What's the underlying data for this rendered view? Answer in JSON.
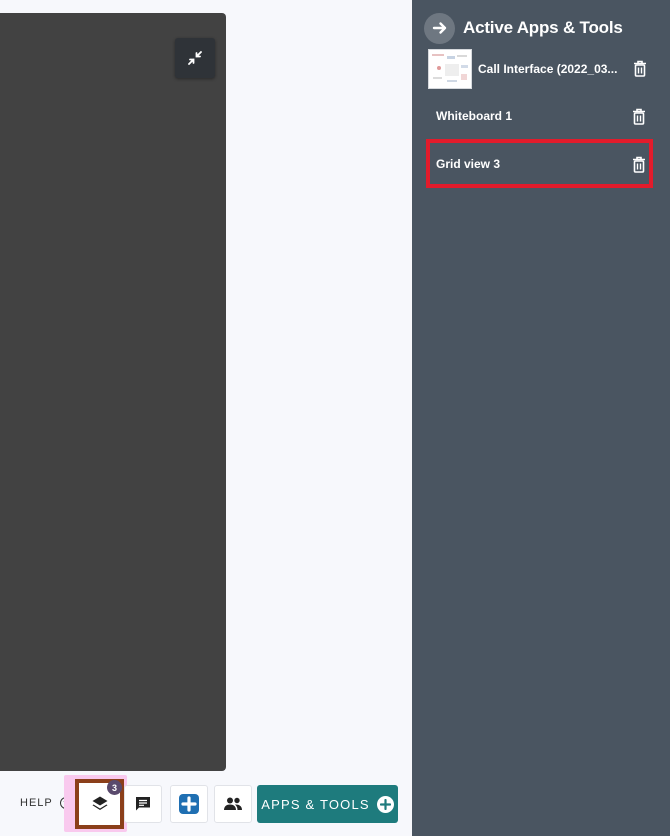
{
  "panel": {
    "title": "Active Apps & Tools",
    "items": [
      {
        "label": "Call Interface (2022_03..."
      },
      {
        "label": "Whiteboard 1"
      },
      {
        "label": "Grid view 3"
      }
    ]
  },
  "toolbar": {
    "help_label": "HELP",
    "help_icon_glyph": "?",
    "layers_badge": "3",
    "apps_tools_label": "APPS & TOOLS"
  },
  "colors": {
    "panel_bg": "#4a5561",
    "stage_bg": "#424242",
    "apps_button": "#1e7b7d",
    "highlight_red": "#e21b2b",
    "plus_blue": "#1f6fb2"
  },
  "icons": {
    "minimize": "minimize-arrows-icon",
    "back": "arrow-right-icon",
    "trash": "trash-icon",
    "layers": "layers-icon",
    "chat": "chat-icon",
    "plus": "plus-square-icon",
    "people": "people-icon"
  }
}
